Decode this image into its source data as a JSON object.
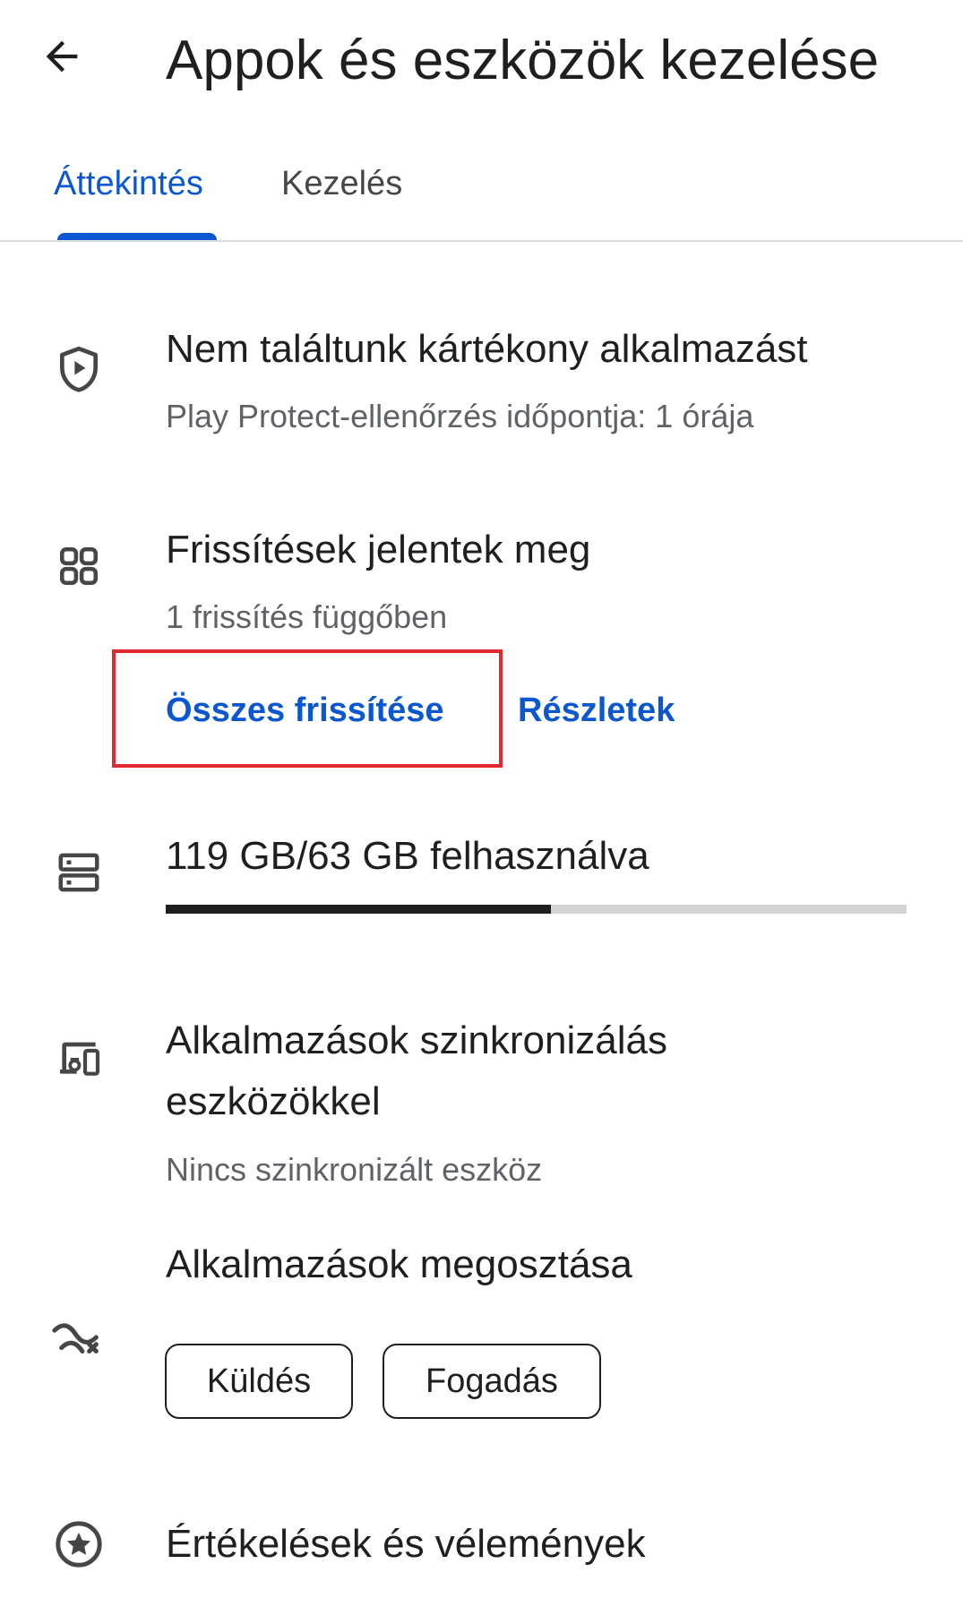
{
  "header": {
    "back_icon": "arrow-back-icon",
    "title": "Appok és eszközök kezelése"
  },
  "tabs": [
    {
      "label": "Áttekintés",
      "selected": true
    },
    {
      "label": "Kezelés",
      "selected": false
    }
  ],
  "colors": {
    "accent": "#0b57d0",
    "highlight": "#e0282e",
    "text": "#1f1f1f",
    "secondary_text": "#5f6368"
  },
  "protect": {
    "icon": "shield-play-icon",
    "title": "Nem találtunk kártékony alkalmazást",
    "subtitle": "Play Protect-ellenőrzés időpontja: 1 órája"
  },
  "updates": {
    "icon": "apps-grid-icon",
    "title": "Frissítések jelentek meg",
    "subtitle": "1 frissítés függőben",
    "update_all_label": "Összes frissítése",
    "details_label": "Részletek"
  },
  "storage": {
    "icon": "storage-icon",
    "title": "119 GB/63 GB felhasználva",
    "used_fraction": 0.52
  },
  "sync": {
    "icon": "devices-icon",
    "title_line1": "Alkalmazások szinkronizálás",
    "title_line2": "eszközökkel",
    "subtitle": "Nincs szinkronizált eszköz"
  },
  "share": {
    "icon": "nearby-share-icon",
    "title": "Alkalmazások megosztása",
    "send_label": "Küldés",
    "receive_label": "Fogadás"
  },
  "ratings": {
    "icon": "star-circle-icon",
    "title": "Értékelések és vélemények"
  }
}
